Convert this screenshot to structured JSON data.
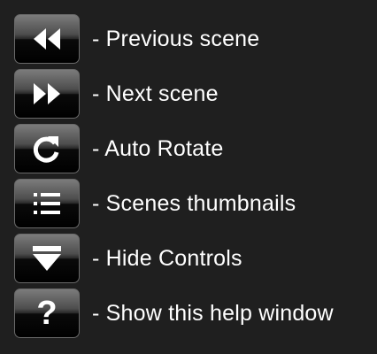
{
  "help_items": [
    {
      "icon": "rewind-icon",
      "label": "- Previous scene"
    },
    {
      "icon": "fast-forward-icon",
      "label": "- Next scene"
    },
    {
      "icon": "rotate-icon",
      "label": "- Auto Rotate"
    },
    {
      "icon": "list-icon",
      "label": "- Scenes thumbnails"
    },
    {
      "icon": "hide-triangle-icon",
      "label": "- Hide Controls"
    },
    {
      "icon": "question-mark-icon",
      "label": "- Show this help window",
      "glyph": "?"
    }
  ],
  "colors": {
    "background": "#1f1f1f",
    "text": "#ffffff",
    "button_top": "#7b7b7b",
    "button_bottom": "#000000"
  }
}
